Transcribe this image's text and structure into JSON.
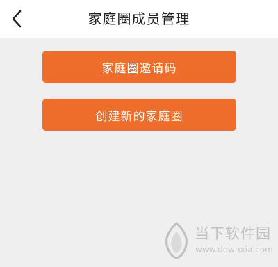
{
  "header": {
    "title": "家庭圈成员管理",
    "back_icon": "chevron-left-icon"
  },
  "actions": {
    "invite_code_label": "家庭圈邀请码",
    "create_family_label": "创建新的家庭圈"
  },
  "watermark": {
    "name": "当下软件园",
    "url": "www.downxia.com"
  },
  "colors": {
    "accent": "#ee6d2a",
    "background": "#efefef",
    "header_bg": "#ffffff"
  }
}
